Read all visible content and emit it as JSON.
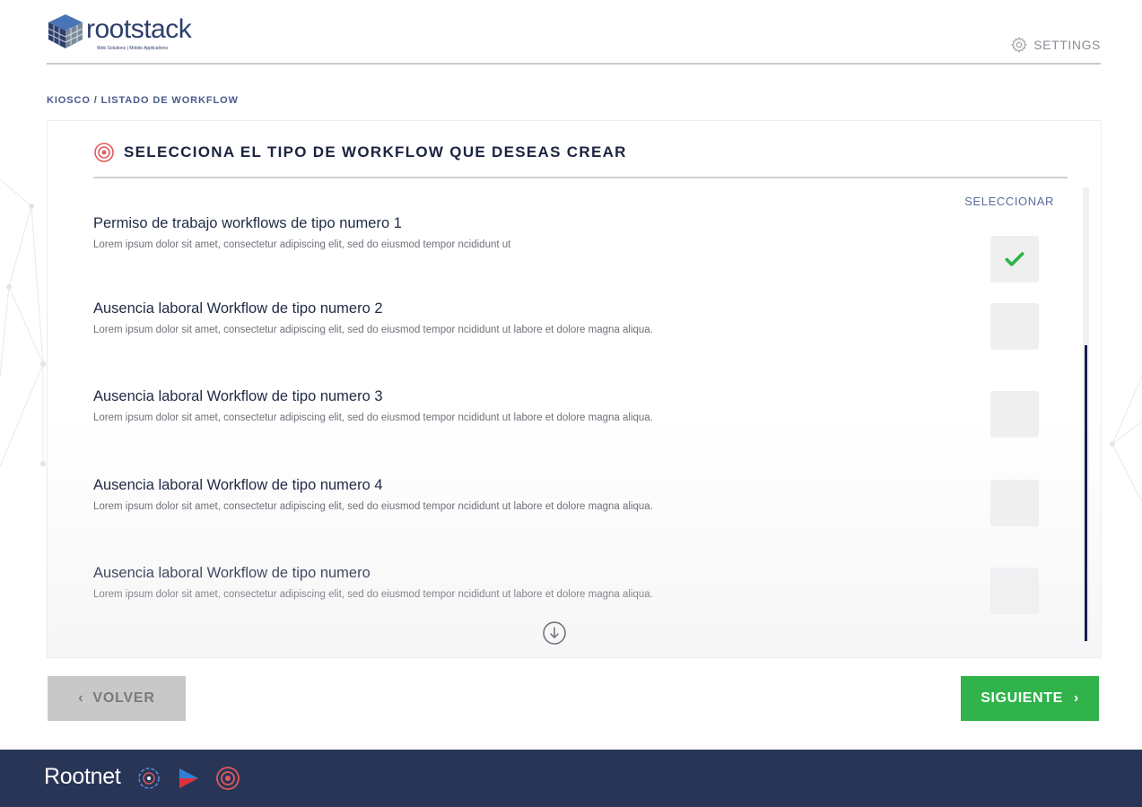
{
  "header": {
    "logo_text": "rootstack",
    "logo_tagline": "Web Solutions | Mobile Applications",
    "settings_label": "SETTINGS"
  },
  "breadcrumb": "KIOSCO / LISTADO DE WORKFLOW",
  "card": {
    "title": "SELECCIONA EL TIPO DE WORKFLOW QUE DESEAS CREAR",
    "select_column_label": "SELECCIONAR",
    "items": [
      {
        "title": "Permiso de trabajo workflows de tipo numero 1",
        "description": "Lorem ipsum dolor sit amet, consectetur adipiscing elit, sed do eiusmod tempor ncididunt ut",
        "selected": true
      },
      {
        "title": "Ausencia laboral Workflow de tipo numero 2",
        "description": "Lorem ipsum dolor sit amet, consectetur adipiscing elit, sed do eiusmod tempor ncididunt ut labore et dolore magna aliqua.",
        "selected": false
      },
      {
        "title": "Ausencia laboral Workflow de tipo numero 3",
        "description": "Lorem ipsum dolor sit amet, consectetur adipiscing elit, sed do eiusmod tempor ncididunt ut labore et dolore magna aliqua.",
        "selected": false
      },
      {
        "title": "Ausencia laboral Workflow de tipo numero 4",
        "description": "Lorem ipsum dolor sit amet, consectetur adipiscing elit, sed do eiusmod tempor ncididunt ut labore et dolore magna aliqua.",
        "selected": false
      },
      {
        "title": "Ausencia laboral Workflow de tipo numero",
        "description": "Lorem ipsum dolor sit amet, consectetur adipiscing elit, sed do eiusmod tempor ncididunt ut labore et dolore magna aliqua.",
        "selected": false
      }
    ]
  },
  "buttons": {
    "back_label": "VOLVER",
    "next_label": "SIGUIENTE"
  },
  "footer": {
    "brand": "Rootnet",
    "icons": [
      "globe-icon",
      "play-icon",
      "target-icon"
    ]
  },
  "colors": {
    "primary_navy": "#283556",
    "accent_green": "#2fb34a",
    "check_green": "#2fb34a",
    "scroll_thumb": "#1a1d4e",
    "title_icon_red": "#e05a5a"
  }
}
